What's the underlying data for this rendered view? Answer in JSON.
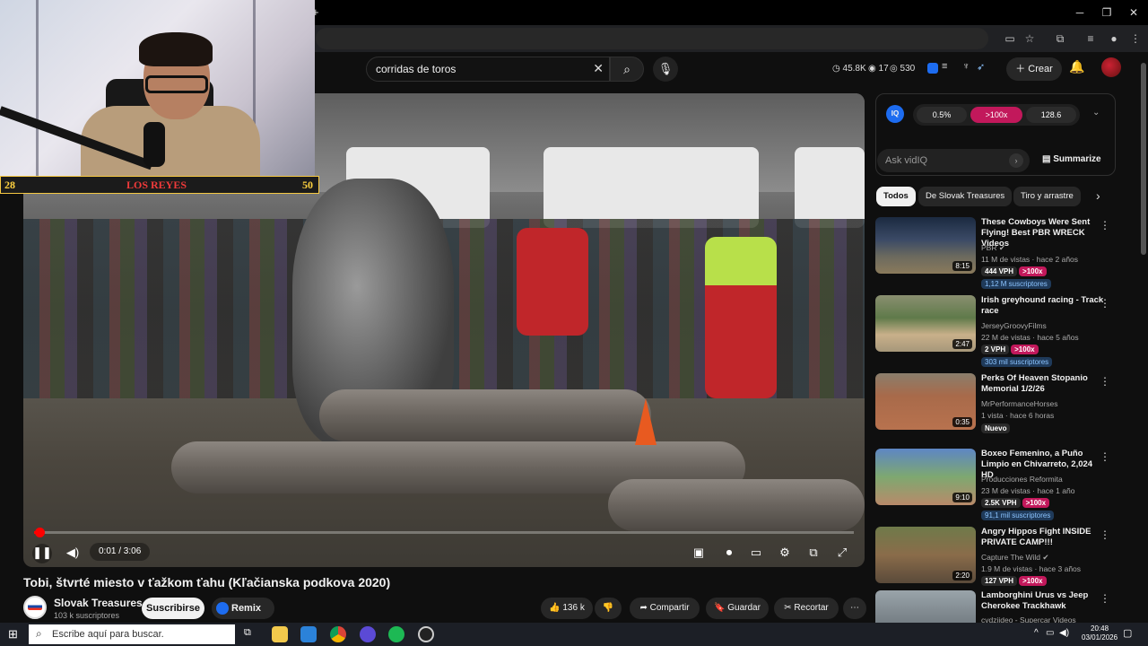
{
  "search": {
    "query": "corridas de toros"
  },
  "header": {
    "stats": {
      "views": "45.8K",
      "likes": "17",
      "eye": "530"
    },
    "create_label": "Crear"
  },
  "player": {
    "time": "0:01 / 3:06",
    "progress_fraction": 0.005
  },
  "overlay": {
    "score_left": "28",
    "name": "LOS REYES",
    "score_right": "50"
  },
  "video": {
    "title": "Tobi, štvrté miesto v ťažkom ťahu (Kľačianska podkova 2020)",
    "channel": "Slovak Treasures",
    "subs": "103 k suscriptores",
    "subscribe_label": "Suscribirse",
    "remix_label": "Remix",
    "likes": "136 k",
    "share_label": "Compartir",
    "save_label": "Guardar",
    "clip_label": "Recortar"
  },
  "vidiq": {
    "logo": "IQ",
    "stat1": "0.5%",
    "stat2": ">100x",
    "stat3": "128.6",
    "ask_placeholder": "Ask vidIQ",
    "summarize_label": "Summarize"
  },
  "chips": [
    "Todos",
    "De Slovak Treasures",
    "Tiro y arrastre"
  ],
  "recommendations": [
    {
      "title": "These Cowboys Were Sent Flying! Best PBR WRECK Videos",
      "channel": "PBR",
      "meta": "11 M de vistas · hace 2 años",
      "vph": "444 VPH",
      "mult": ">100x",
      "subs": "1,12 M suscriptores",
      "duration": "8:15"
    },
    {
      "title": "Irish greyhound racing - Track race",
      "channel": "JerseyGroovyFilms",
      "meta": "22 M de vistas · hace 5 años",
      "vph": "2 VPH",
      "mult": ">100x",
      "subs": "303 mil suscriptores",
      "duration": "2:47"
    },
    {
      "title": "Perks Of Heaven Stopanio Memorial 1/2/26",
      "channel": "MrPerformanceHorses",
      "meta": "1 vista · hace 6 horas",
      "badge": "Nuevo",
      "duration": "0:35"
    },
    {
      "title": "Boxeo Femenino, a Puño Limpio en Chivarreto, 2,024 HD",
      "channel": "Producciones Reformita",
      "meta": "23 M de vistas · hace 1 año",
      "vph": "2.5K VPH",
      "mult": ">100x",
      "subs": "91,1 mil suscriptores",
      "duration": "9:10"
    },
    {
      "title": "Angry Hippos Fight INSIDE PRIVATE CAMP!!!",
      "channel": "Capture The Wild",
      "meta": "1.9 M de vistas · hace 3 años",
      "vph": "127 VPH",
      "mult": ">100x",
      "duration": "2:20"
    },
    {
      "title": "Lamborghini Urus vs Jeep Cherokee Trackhawk",
      "channel": "cvdziideo - Supercar Videos"
    }
  ],
  "taskbar": {
    "search_placeholder": "Escribe aquí para buscar.",
    "time": "20:48",
    "date": "03/01/2026"
  }
}
